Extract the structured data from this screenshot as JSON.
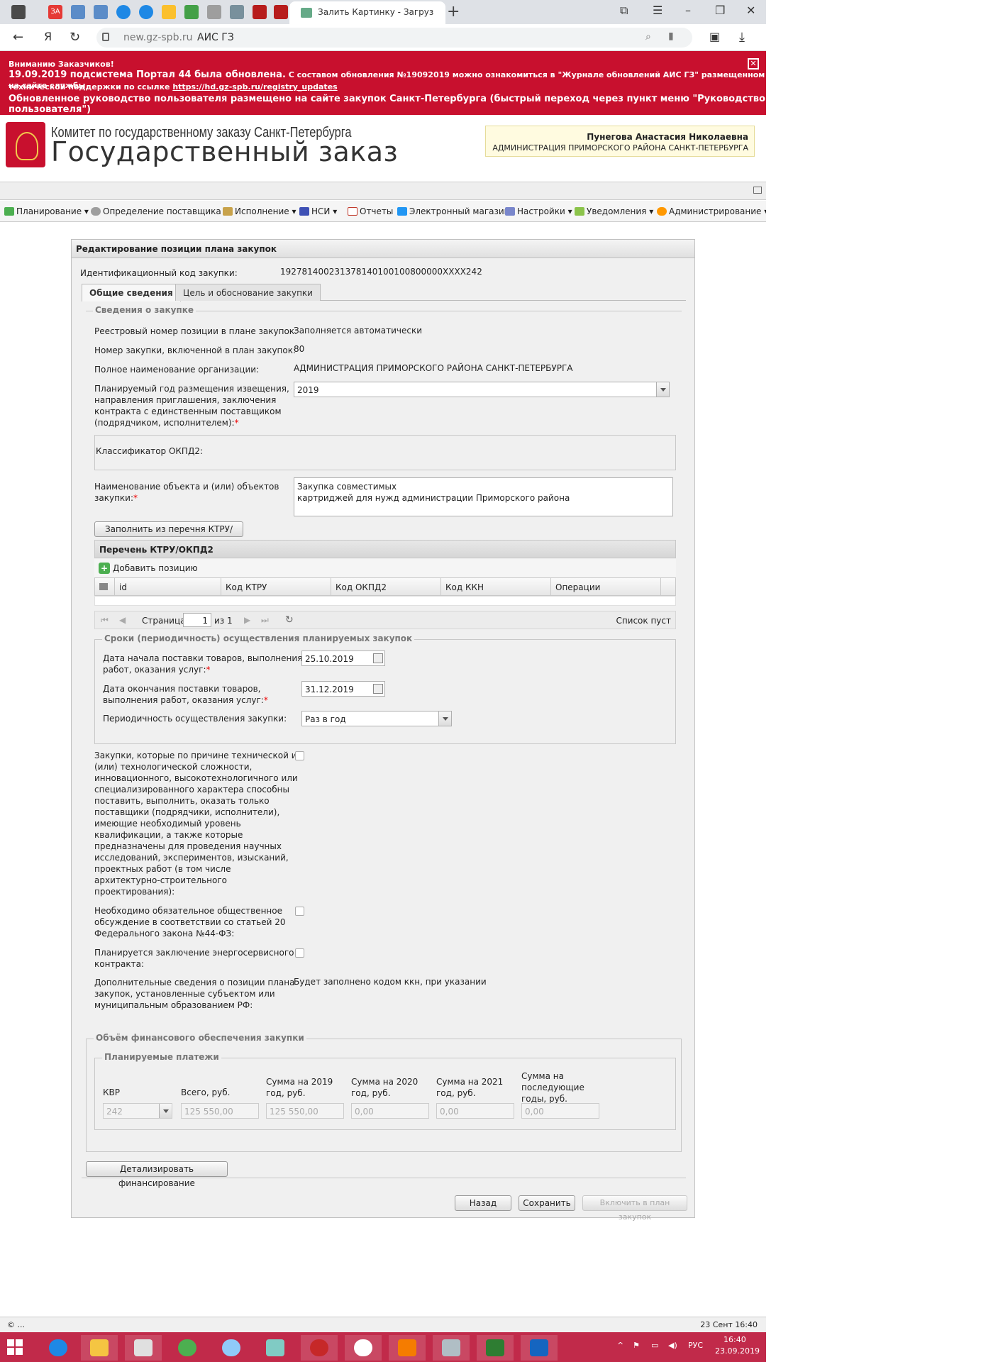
{
  "browser": {
    "tab_title": "Залить Картинку - Загруз",
    "yandex_letter": "Я",
    "url_host": "new.gz-spb.ru",
    "page_title": "АИС ГЗ"
  },
  "alert": {
    "line1": "Вниманию Заказчиков!",
    "line2_main": "19.09.2019 подсистема Портал 44 была обновлена.",
    "line2_rest": " С составом обновления №19092019 можно ознакомиться в \"Журнале обновлений АИС ГЗ\" размещенном на сайте службы",
    "line3": "технической поддержки по ссылке ",
    "line3_link": "https://hd.gz-spb.ru/registry_updates",
    "line4": "Обновленное руководство пользователя размещено на сайте закупок Санкт-Петербурга (быстрый переход через пункт меню \"Руководство пользователя\")"
  },
  "header": {
    "org_line": "Комитет по государственному заказу Санкт-Петербурга",
    "title": "Государственный заказ",
    "user_name": "Пунегова Анастасия Николаевна",
    "user_org": "АДМИНИСТРАЦИЯ ПРИМОРСКОГО РАЙОНА САНКТ-ПЕТЕРБУРГА"
  },
  "menu": {
    "items": [
      "Планирование ▾",
      "Определение поставщика ▾",
      "Исполнение ▾",
      "НСИ ▾",
      "Отчеты",
      "Электронный магазин",
      "Настройки ▾",
      "Уведомления ▾",
      "Администрирование ▾"
    ]
  },
  "form": {
    "title": "Редактирование позиции плана закупок",
    "ikz_label": "Идентификационный код закупки:",
    "ikz_value": "192781400231378140100100800000XXXX242",
    "tabs": [
      "Общие сведения",
      "Цель и обоснование закупки"
    ],
    "legend_info": "Сведения о закупке",
    "reg_label": "Реестровый номер позиции в плане закупок:",
    "reg_value": "Заполняется автоматически",
    "num_label": "Номер закупки, включенной в план закупок:",
    "num_value": "80",
    "org_label": "Полное наименование организации:",
    "org_value": "АДМИНИСТРАЦИЯ ПРИМОРСКОГО РАЙОНА САНКТ-ПЕТЕРБУРГА",
    "year_label_1": "Планируемый год размещения извещения,",
    "year_label_2": "направления приглашения, заключения",
    "year_label_3": "контракта с единственным поставщиком",
    "year_label_4": "(подрядчиком, исполнителем):",
    "year_value": "2019",
    "okpd_label": "Классификатор ОКПД2:",
    "obj_label_1": "Наименование объекта и (или) объектов",
    "obj_label_2": "закупки:",
    "obj_value_1": "Закупка совместимых",
    "obj_value_2": "картриджей для нужд администрации Приморского района",
    "fill_button": "Заполнить из перечня КТРУ/ОКПД2",
    "grid_title": "Перечень КТРУ/ОКПД2",
    "add_position": "Добавить позицию",
    "grid_cols": [
      "id",
      "Код КТРУ",
      "Код ОКПД2",
      "Код ККН",
      "Операции"
    ],
    "pager_page": "Страница",
    "pager_value": "1",
    "pager_of": "из 1",
    "pager_empty": "Список пуст",
    "legend_terms": "Сроки (периодичность) осуществления планируемых закупок",
    "start_label_1": "Дата начала поставки товаров, выполнения",
    "start_label_2": "работ, оказания услуг:",
    "start_value": "25.10.2019",
    "end_label_1": "Дата окончания поставки товаров,",
    "end_label_2": "выполнения работ, оказания услуг:",
    "end_value": "31.12.2019",
    "period_label": "Периодичность осуществления закупки:",
    "period_value": "Раз в год",
    "tech_label": [
      "Закупки, которые по причине технической и",
      "(или) технологической сложности,",
      "инновационного, высокотехнологичного или",
      "специализированного характера способны",
      "поставить, выполнить, оказать только",
      "поставщики (подрядчики, исполнители),",
      "имеющие необходимый уровень",
      "квалификации, а также которые",
      "предназначены для проведения научных",
      "исследований, экспериментов, изысканий,",
      "проектных работ (в том числе",
      "архитектурно-строительного",
      "проектирования):"
    ],
    "public_label": [
      "Необходимо обязательное общественное",
      "обсуждение в соответствии со статьей 20",
      "Федерального закона №44-ФЗ:"
    ],
    "energy_label": [
      "Планируется заключение энергосервисного",
      "контракта:"
    ],
    "extra_label": [
      "Дополнительные сведения о позиции плана",
      "закупок, установленные субъектом или",
      "муниципальным образованием РФ:"
    ],
    "extra_value": "Будет заполнено кодом ккн, при указании",
    "legend_fin": "Объём финансового обеспечения закупки",
    "legend_pay": "Планируемые платежи",
    "kvr_label": "КВР",
    "total_label": "Всего, руб.",
    "s2019_label": [
      "Сумма на 2019",
      "год, руб."
    ],
    "s2020_label": [
      "Сумма на 2020",
      "год, руб."
    ],
    "s2021_label": [
      "Сумма на 2021",
      "год, руб."
    ],
    "snext_label": [
      "Сумма на",
      "последующие",
      "годы, руб."
    ],
    "kvr_value": "242",
    "total_value": "125 550,00",
    "s2019_value": "125 550,00",
    "s2020_value": "0,00",
    "s2021_value": "0,00",
    "snext_value": "0,00",
    "detail_button": "Детализировать финансирование",
    "back_button": "Назад",
    "save_button": "Сохранить",
    "include_button": "Включить в план закупок"
  },
  "statusbar": {
    "left": "© ...",
    "right": "23 Сент 16:40"
  },
  "taskbar": {
    "lang": "РУС",
    "time": "16:40",
    "date": "23.09.2019"
  }
}
